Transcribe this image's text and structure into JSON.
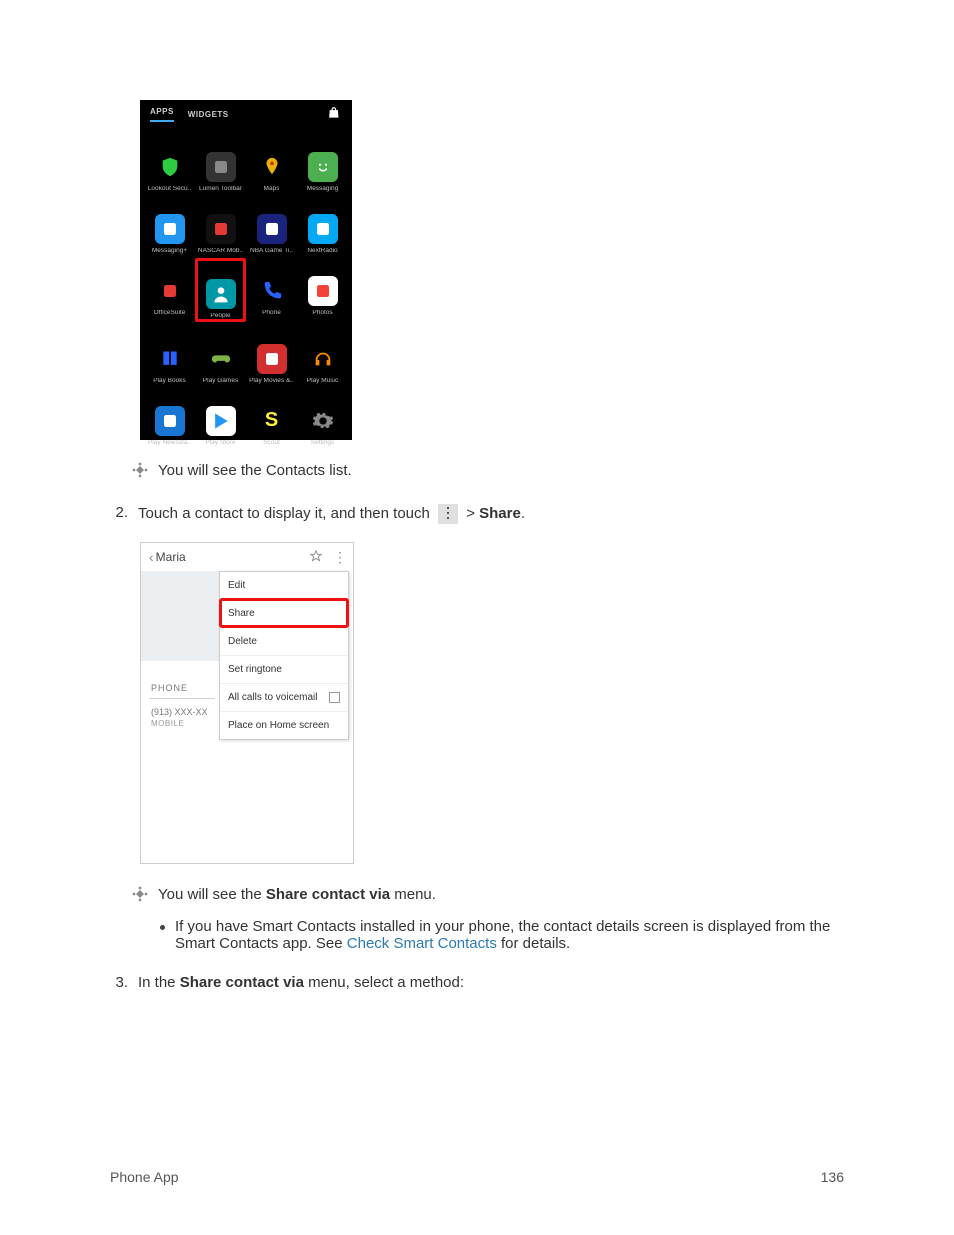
{
  "shot1": {
    "tabs": {
      "apps": "APPS",
      "widgets": "WIDGETS"
    },
    "apps": [
      {
        "label": "Lookout Secu..",
        "bg": "#000",
        "glyph": "shield",
        "fg": "#2ecc40"
      },
      {
        "label": "Lumen Toolbar",
        "bg": "#333",
        "glyph": "swirl",
        "fg": "#888"
      },
      {
        "label": "Maps",
        "bg": "#000",
        "glyph": "maps",
        "fg": "#e7b300"
      },
      {
        "label": "Messaging",
        "bg": "#4caf50",
        "glyph": "smile",
        "fg": "#fff"
      },
      {
        "label": "Messaging+",
        "bg": "#2196f3",
        "glyph": "plus",
        "fg": "#fff"
      },
      {
        "label": "NASCAR Mob..",
        "bg": "#111",
        "glyph": "nascar",
        "fg": "#e53935"
      },
      {
        "label": "NBA Game Ti..",
        "bg": "#1a237e",
        "glyph": "nba",
        "fg": "#fff"
      },
      {
        "label": "NextRadio",
        "bg": "#03a9f4",
        "glyph": "radio",
        "fg": "#fff"
      },
      {
        "label": "OfficeSuite",
        "bg": "#000",
        "glyph": "office",
        "fg": "#e53935"
      },
      {
        "label": "People",
        "bg": "#0097a7",
        "glyph": "person",
        "fg": "#fff",
        "highlight": true
      },
      {
        "label": "Phone",
        "bg": "#000",
        "glyph": "phone",
        "fg": "#2962ff"
      },
      {
        "label": "Photos",
        "bg": "#fff",
        "glyph": "pinwheel",
        "fg": "#f44336"
      },
      {
        "label": "Play Books",
        "bg": "#000",
        "glyph": "book",
        "fg": "#2962ff"
      },
      {
        "label": "Play Games",
        "bg": "#000",
        "glyph": "gamepad",
        "fg": "#7cb342"
      },
      {
        "label": "Play Movies &..",
        "bg": "#d32f2f",
        "glyph": "film",
        "fg": "#fff"
      },
      {
        "label": "Play Music",
        "bg": "#000",
        "glyph": "headphones",
        "fg": "#fb8c00"
      },
      {
        "label": "Play Newssta..",
        "bg": "#1976d2",
        "glyph": "news",
        "fg": "#fff"
      },
      {
        "label": "Play Store",
        "bg": "#fff",
        "glyph": "play",
        "fg": "#2196f3"
      },
      {
        "label": "Scout",
        "bg": "#000",
        "glyph": "S",
        "fg": "#ffeb3b"
      },
      {
        "label": "Settings",
        "bg": "#000",
        "glyph": "gear",
        "fg": "#888"
      }
    ]
  },
  "note1": "You will see the Contacts list.",
  "step2": {
    "num": "2.",
    "pre": "Touch a contact to display it, and then touch ",
    "gt": "> ",
    "share": "Share",
    "post": "."
  },
  "shot2": {
    "title": "Maria",
    "menu": [
      "Edit",
      "Share",
      "Delete",
      "Set ringtone",
      "All calls to voicemail",
      "Place on Home screen"
    ],
    "phone_label": "PHONE",
    "phone": "(913) XXX-XX",
    "phone_type": "MOBILE"
  },
  "note2_pre": "You will see the ",
  "note2_bold": "Share contact via",
  "note2_post": " menu.",
  "bullet": {
    "a": "If you have Smart Contacts installed in your phone, the contact details screen is displayed from the Smart Contacts app. See ",
    "link": "Check Smart Contacts",
    "b": " for details."
  },
  "step3": {
    "num": "3.",
    "a": "In the ",
    "bold": "Share contact via",
    "b": " menu, select a method:"
  },
  "footer": {
    "left": "Phone App",
    "right": "136"
  }
}
